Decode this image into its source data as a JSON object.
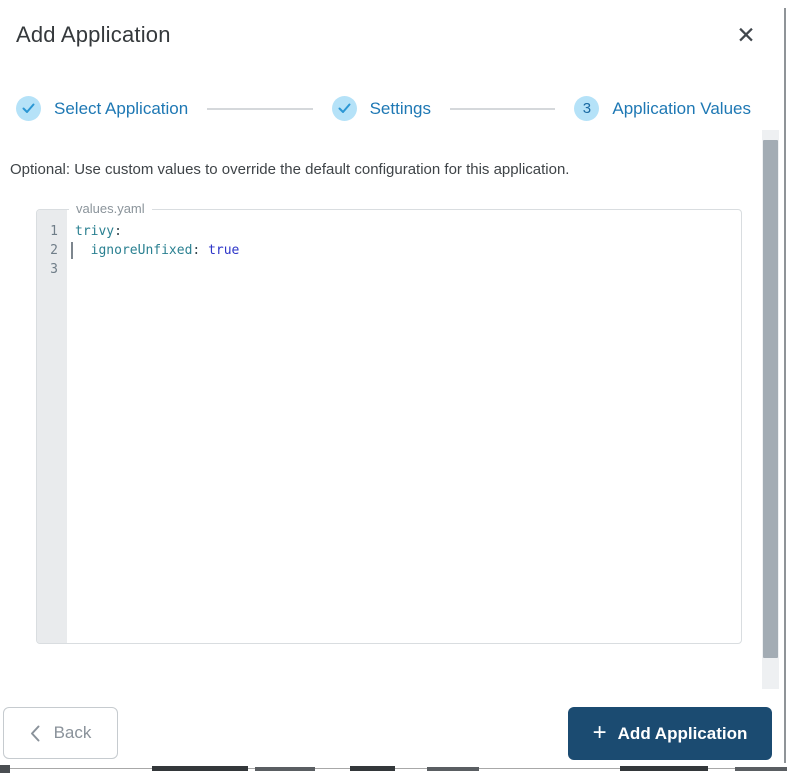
{
  "modal": {
    "title": "Add Application",
    "close_icon": "✕"
  },
  "stepper": {
    "steps": [
      {
        "label": "Select Application",
        "state": "completed",
        "indicator": "check"
      },
      {
        "label": "Settings",
        "state": "completed",
        "indicator": "check"
      },
      {
        "label": "Application Values",
        "state": "active",
        "indicator": "3"
      }
    ]
  },
  "description": "Optional: Use custom values to override the default configuration for this application.",
  "editor": {
    "filename_label": "values.yaml",
    "language": "yaml",
    "line_numbers": [
      "1",
      "2",
      "3"
    ],
    "lines": [
      {
        "tokens": [
          {
            "text": "trivy",
            "type": "key"
          },
          {
            "text": ":",
            "type": "punct"
          }
        ]
      },
      {
        "tokens": [
          {
            "text": "  ",
            "type": "plain"
          },
          {
            "text": "ignoreUnfixed",
            "type": "key"
          },
          {
            "text": ":",
            "type": "punct"
          },
          {
            "text": " ",
            "type": "plain"
          },
          {
            "text": "true",
            "type": "keyword"
          }
        ]
      },
      {
        "tokens": []
      }
    ],
    "content_text": "trivy:\n  ignoreUnfixed: true\n"
  },
  "footer": {
    "back_label": "Back",
    "submit_label": "Add Application",
    "submit_icon": "+"
  },
  "colors": {
    "step_label_blue": "#1e78b4",
    "step_circle_bg": "#b5e2f8",
    "step_check_blue": "#2b97d4",
    "submit_button_bg": "#1b4b71",
    "code_key_teal": "#2a8091",
    "code_keyword_blue": "#2d35c8",
    "gutter_bg": "#e9ebed"
  }
}
